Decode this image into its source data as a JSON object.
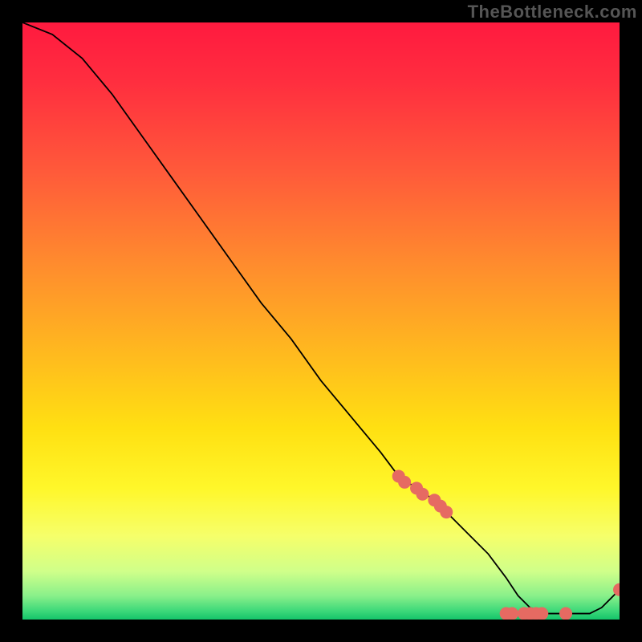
{
  "watermark": "TheBottleneck.com",
  "chart_data": {
    "type": "line",
    "title": "",
    "xlabel": "",
    "ylabel": "",
    "xlim": [
      0,
      100
    ],
    "ylim": [
      0,
      100
    ],
    "series": [
      {
        "name": "curve",
        "x": [
          0,
          5,
          10,
          15,
          20,
          25,
          30,
          35,
          40,
          45,
          50,
          55,
          60,
          63,
          66,
          69,
          72,
          75,
          78,
          81,
          83,
          85,
          88,
          91,
          93,
          95,
          97,
          99,
          100
        ],
        "y": [
          100,
          98,
          94,
          88,
          81,
          74,
          67,
          60,
          53,
          47,
          40,
          34,
          28,
          24,
          22,
          20,
          17,
          14,
          11,
          7,
          4,
          2,
          1,
          1,
          1,
          1,
          2,
          4,
          5
        ]
      }
    ],
    "markers": {
      "name": "dots",
      "color": "#e66a62",
      "radius": 8,
      "points": [
        {
          "x": 63,
          "y": 24
        },
        {
          "x": 64,
          "y": 23
        },
        {
          "x": 66,
          "y": 22
        },
        {
          "x": 67,
          "y": 21
        },
        {
          "x": 69,
          "y": 20
        },
        {
          "x": 70,
          "y": 19
        },
        {
          "x": 71,
          "y": 18
        },
        {
          "x": 81,
          "y": 1
        },
        {
          "x": 82,
          "y": 1
        },
        {
          "x": 84,
          "y": 1
        },
        {
          "x": 85,
          "y": 1
        },
        {
          "x": 86,
          "y": 1
        },
        {
          "x": 87,
          "y": 1
        },
        {
          "x": 91,
          "y": 1
        },
        {
          "x": 100,
          "y": 5
        }
      ]
    },
    "gradient_stops": [
      {
        "offset": 0,
        "color": "#ff1a3f"
      },
      {
        "offset": 0.1,
        "color": "#ff2e3f"
      },
      {
        "offset": 0.25,
        "color": "#ff5a3a"
      },
      {
        "offset": 0.4,
        "color": "#ff8a2e"
      },
      {
        "offset": 0.55,
        "color": "#ffb81f"
      },
      {
        "offset": 0.68,
        "color": "#ffe012"
      },
      {
        "offset": 0.78,
        "color": "#fff72a"
      },
      {
        "offset": 0.86,
        "color": "#f6ff6a"
      },
      {
        "offset": 0.92,
        "color": "#cfff8a"
      },
      {
        "offset": 0.96,
        "color": "#8af08a"
      },
      {
        "offset": 0.985,
        "color": "#3fd97a"
      },
      {
        "offset": 1.0,
        "color": "#14c46a"
      }
    ]
  }
}
